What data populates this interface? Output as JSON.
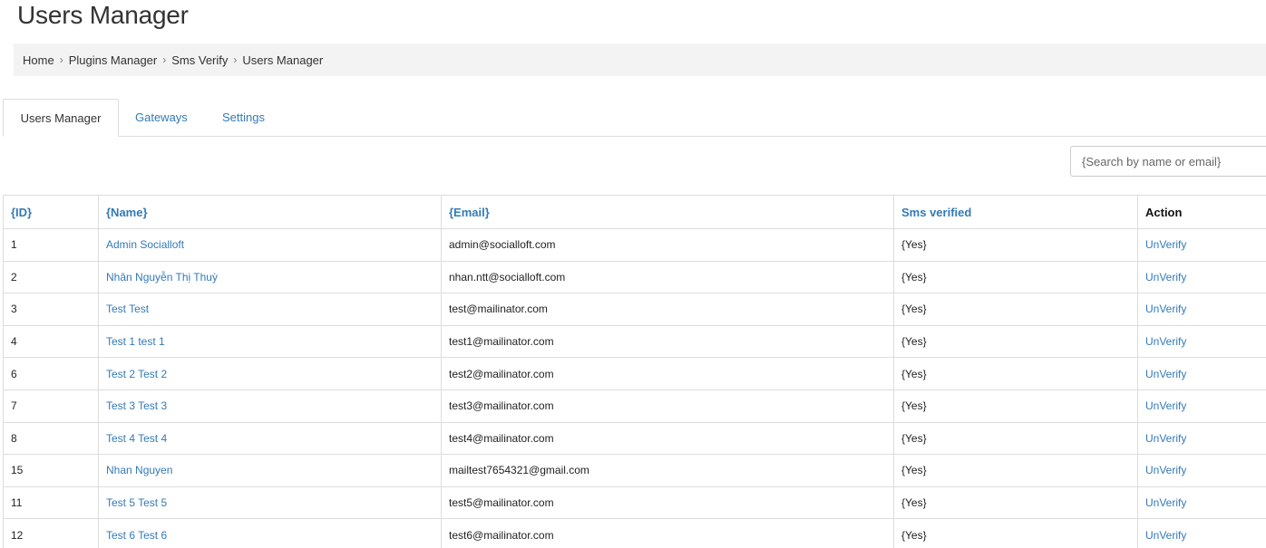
{
  "page": {
    "title": "Users Manager"
  },
  "breadcrumb": {
    "items": [
      "Home",
      "Plugins Manager",
      "Sms Verify",
      "Users Manager"
    ],
    "separator": "›"
  },
  "tabs": [
    {
      "label": "Users Manager",
      "active": true
    },
    {
      "label": "Gateways",
      "active": false
    },
    {
      "label": "Settings",
      "active": false
    }
  ],
  "search": {
    "placeholder": "{Search by name or email}",
    "value": ""
  },
  "table": {
    "headers": {
      "id": "{ID}",
      "name": "{Name}",
      "email": "{Email}",
      "sms_verified": "Sms verified",
      "action": "Action"
    },
    "rows": [
      {
        "id": "1",
        "name": "Admin Socialloft",
        "email": "admin@socialloft.com",
        "sms_verified": "{Yes}",
        "action": "UnVerify"
      },
      {
        "id": "2",
        "name": "Nhân Nguyễn Thị Thuỳ",
        "email": "nhan.ntt@socialloft.com",
        "sms_verified": "{Yes}",
        "action": "UnVerify"
      },
      {
        "id": "3",
        "name": "Test Test",
        "email": "test@mailinator.com",
        "sms_verified": "{Yes}",
        "action": "UnVerify"
      },
      {
        "id": "4",
        "name": "Test 1 test 1",
        "email": "test1@mailinator.com",
        "sms_verified": "{Yes}",
        "action": "UnVerify"
      },
      {
        "id": "6",
        "name": "Test 2 Test 2",
        "email": "test2@mailinator.com",
        "sms_verified": "{Yes}",
        "action": "UnVerify"
      },
      {
        "id": "7",
        "name": "Test 3 Test 3",
        "email": "test3@mailinator.com",
        "sms_verified": "{Yes}",
        "action": "UnVerify"
      },
      {
        "id": "8",
        "name": "Test 4 Test 4",
        "email": "test4@mailinator.com",
        "sms_verified": "{Yes}",
        "action": "UnVerify"
      },
      {
        "id": "15",
        "name": "Nhan Nguyen",
        "email": "mailtest7654321@gmail.com",
        "sms_verified": "{Yes}",
        "action": "UnVerify"
      },
      {
        "id": "11",
        "name": "Test 5 Test 5",
        "email": "test5@mailinator.com",
        "sms_verified": "{Yes}",
        "action": "UnVerify"
      },
      {
        "id": "12",
        "name": "Test 6 Test 6",
        "email": "test6@mailinator.com",
        "sms_verified": "{Yes}",
        "action": "UnVerify"
      }
    ]
  },
  "colors": {
    "link": "#337ab7",
    "text": "#222222",
    "border": "#dddddd",
    "breadcrumb_bg": "#f3f3f3"
  }
}
